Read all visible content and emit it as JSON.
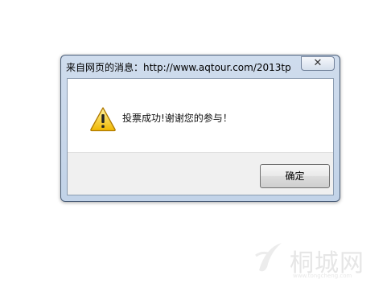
{
  "dialog": {
    "title": "来自网页的消息：http://www.aqtour.com/2013tp...",
    "close_label": "✕",
    "message": "投票成功!谢谢您的参与！",
    "icon": "warning-icon",
    "ok_label": "确定"
  },
  "watermark": {
    "text": "桐城网",
    "subtext": "www.tongcheng.com"
  }
}
